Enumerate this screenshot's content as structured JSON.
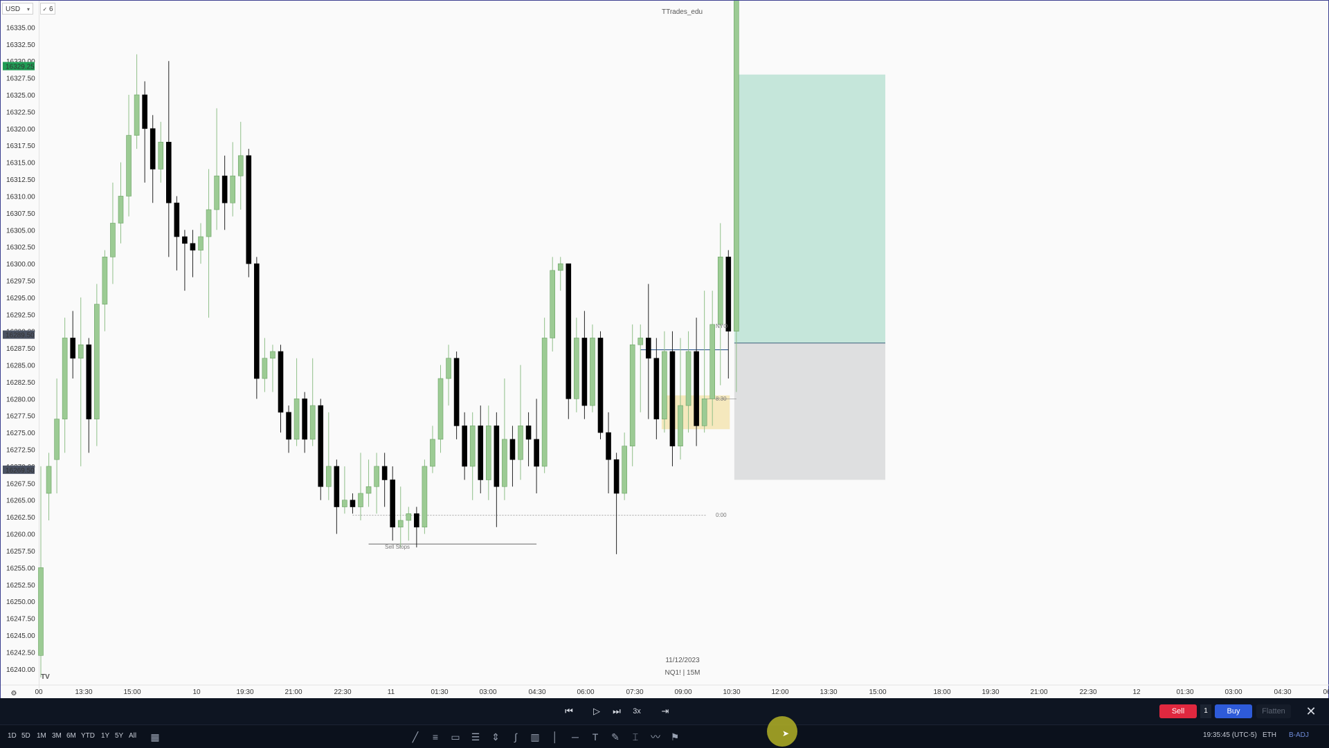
{
  "toolbar": {
    "currency": "USD",
    "interval_badge": "6"
  },
  "chart_data": {
    "type": "candlestick",
    "title": "",
    "y_ticks": [
      "16335.00",
      "16332.50",
      "16330.00",
      "16327.50",
      "16325.00",
      "16322.50",
      "16320.00",
      "16317.50",
      "16315.00",
      "16312.50",
      "16310.00",
      "16307.50",
      "16305.00",
      "16302.50",
      "16300.00",
      "16297.50",
      "16295.00",
      "16292.50",
      "16290.00",
      "16287.50",
      "16285.00",
      "16282.50",
      "16280.00",
      "16277.50",
      "16275.00",
      "16272.50",
      "16270.00",
      "16267.50",
      "16265.00",
      "16262.50",
      "16260.00",
      "16257.50",
      "16255.00",
      "16252.50",
      "16250.00",
      "16247.50",
      "16245.00",
      "16242.50",
      "16240.00"
    ],
    "ylim": [
      16238.75,
      16337.5
    ],
    "price_badges": [
      {
        "value": "16329.25",
        "color": "#1f9d55"
      },
      {
        "value": "16289.50",
        "color": "#4a5263"
      },
      {
        "value": "16269.50",
        "color": "#4a5263"
      }
    ],
    "x_ticks": [
      "00",
      "13:30",
      "15:00",
      "10",
      "19:30",
      "21:00",
      "22:30",
      "11",
      "01:30",
      "03:00",
      "04:30",
      "06:00",
      "07:30",
      "09:00",
      "10:30",
      "12:00",
      "13:30",
      "15:00",
      "18:00",
      "19:30",
      "21:00",
      "22:30",
      "12",
      "01:30",
      "03:00",
      "04:30",
      "06"
    ],
    "up_color": "#9ccb94",
    "down_color": "#000000",
    "candles": [
      [
        16242,
        16255,
        16238.75,
        16270,
        1
      ],
      [
        16266,
        16270,
        16262,
        16272,
        1
      ],
      [
        16271,
        16277,
        16266,
        16283,
        1
      ],
      [
        16277,
        16289,
        16272,
        16292,
        1
      ],
      [
        16289,
        16286,
        16283,
        16293,
        0
      ],
      [
        16286,
        16288,
        16270,
        16295,
        1
      ],
      [
        16288,
        16277,
        16272,
        16289,
        0
      ],
      [
        16277,
        16294,
        16273,
        16297,
        1
      ],
      [
        16294,
        16301,
        16290,
        16302,
        1
      ],
      [
        16301,
        16306,
        16297,
        16312,
        1
      ],
      [
        16306,
        16310,
        16303,
        16315,
        1
      ],
      [
        16310,
        16319,
        16307,
        16325,
        1
      ],
      [
        16319,
        16325,
        16317,
        16331,
        1
      ],
      [
        16325,
        16320,
        16312,
        16327,
        0
      ],
      [
        16320,
        16314,
        16309,
        16322,
        0
      ],
      [
        16314,
        16318,
        16312,
        16321,
        1
      ],
      [
        16318,
        16309,
        16301,
        16330,
        0
      ],
      [
        16309,
        16304,
        16299,
        16310,
        0
      ],
      [
        16304,
        16303,
        16296,
        16305,
        0
      ],
      [
        16303,
        16302,
        16298,
        16305,
        0
      ],
      [
        16302,
        16304,
        16300,
        16306,
        1
      ],
      [
        16304,
        16308,
        16292,
        16314,
        1
      ],
      [
        16308,
        16313,
        16305,
        16323,
        1
      ],
      [
        16313,
        16309,
        16305,
        16316,
        0
      ],
      [
        16309,
        16313,
        16307,
        16318,
        1
      ],
      [
        16313,
        16316,
        16308,
        16321,
        1
      ],
      [
        16316,
        16300,
        16298,
        16317,
        0
      ],
      [
        16300,
        16283,
        16280,
        16301,
        0
      ],
      [
        16283,
        16286,
        16281,
        16289,
        1
      ],
      [
        16286,
        16287,
        16281,
        16288,
        1
      ],
      [
        16287,
        16278,
        16275,
        16288,
        0
      ],
      [
        16278,
        16274,
        16272,
        16279,
        0
      ],
      [
        16274,
        16280,
        16273,
        16286,
        1
      ],
      [
        16280,
        16274,
        16272,
        16281,
        0
      ],
      [
        16274,
        16279,
        16273,
        16286,
        1
      ],
      [
        16279,
        16267,
        16265,
        16280,
        0
      ],
      [
        16267,
        16270,
        16265,
        16278,
        1
      ],
      [
        16270,
        16264,
        16260,
        16271,
        0
      ],
      [
        16264,
        16265,
        16263,
        16270,
        1
      ],
      [
        16265,
        16264,
        16263,
        16266,
        0
      ],
      [
        16264,
        16266,
        16262,
        16272,
        1
      ],
      [
        16266,
        16267,
        16264,
        16271,
        1
      ],
      [
        16267,
        16270,
        16263,
        16272,
        1
      ],
      [
        16270,
        16268,
        16264,
        16272,
        0
      ],
      [
        16268,
        16261,
        16259,
        16270,
        0
      ],
      [
        16261,
        16262,
        16258,
        16267,
        1
      ],
      [
        16262,
        16263,
        16259,
        16264,
        1
      ],
      [
        16263,
        16261,
        16258,
        16264,
        0
      ],
      [
        16261,
        16270,
        16260,
        16271,
        1
      ],
      [
        16270,
        16274,
        16269,
        16276,
        1
      ],
      [
        16274,
        16283,
        16272,
        16285,
        1
      ],
      [
        16283,
        16286,
        16279,
        16288,
        1
      ],
      [
        16286,
        16276,
        16274,
        16287,
        0
      ],
      [
        16276,
        16270,
        16268,
        16278,
        0
      ],
      [
        16270,
        16276,
        16265,
        16278,
        1
      ],
      [
        16276,
        16268,
        16266,
        16279,
        0
      ],
      [
        16268,
        16276,
        16265,
        16279,
        1
      ],
      [
        16276,
        16267,
        16261,
        16278,
        0
      ],
      [
        16267,
        16274,
        16265,
        16283,
        1
      ],
      [
        16274,
        16271,
        16267,
        16276,
        0
      ],
      [
        16271,
        16276,
        16268,
        16285,
        1
      ],
      [
        16276,
        16274,
        16270,
        16278,
        0
      ],
      [
        16274,
        16270,
        16266,
        16280,
        0
      ],
      [
        16270,
        16289,
        16269,
        16292,
        1
      ],
      [
        16289,
        16299,
        16287,
        16301,
        1
      ],
      [
        16299,
        16300,
        16296,
        16301,
        1
      ],
      [
        16300,
        16280,
        16277,
        16300,
        0
      ],
      [
        16280,
        16289,
        16278,
        16292,
        1
      ],
      [
        16289,
        16279,
        16277,
        16293,
        0
      ],
      [
        16279,
        16289,
        16278,
        16291,
        1
      ],
      [
        16289,
        16275,
        16274,
        16290,
        0
      ],
      [
        16275,
        16271,
        16266,
        16278,
        0
      ],
      [
        16271,
        16266,
        16257,
        16272,
        0
      ],
      [
        16266,
        16273,
        16265,
        16275,
        1
      ],
      [
        16273,
        16288,
        16270,
        16291,
        1
      ],
      [
        16288,
        16289,
        16278,
        16291,
        1
      ],
      [
        16289,
        16286,
        16277,
        16297,
        0
      ],
      [
        16286,
        16277,
        16274,
        16289,
        0
      ],
      [
        16277,
        16287,
        16275,
        16290,
        1
      ],
      [
        16287,
        16273,
        16270,
        16290,
        0
      ],
      [
        16273,
        16279,
        16271,
        16289,
        1
      ],
      [
        16279,
        16287,
        16275,
        16290,
        1
      ],
      [
        16287,
        16276,
        16273,
        16292,
        0
      ],
      [
        16276,
        16280,
        16275,
        16296,
        1
      ],
      [
        16280,
        16291,
        16276,
        16296,
        1
      ],
      [
        16291,
        16301,
        16282,
        16306,
        1
      ],
      [
        16301,
        16290,
        16283,
        16302,
        0
      ],
      [
        16290,
        16353,
        16281,
        16353,
        1
      ],
      [
        16353,
        16353,
        16352,
        16353,
        0
      ]
    ],
    "annotations": [
      {
        "text": "TTrades_edu"
      },
      {
        "text": "NYO"
      },
      {
        "text": "8:30"
      },
      {
        "text": "0:00"
      },
      {
        "text": "Sell Stops"
      },
      {
        "text": "11/12/2023"
      },
      {
        "text": "NQ1! | 15M"
      }
    ],
    "position_target_color": "#c5e6da",
    "position_stop_color": "#dedfe0",
    "fvg_color": "#f5e8bd"
  },
  "replay": {
    "speed_label": "3x"
  },
  "timeframes": [
    "1D",
    "5D",
    "1M",
    "3M",
    "6M",
    "YTD",
    "1Y",
    "5Y",
    "All"
  ],
  "trade": {
    "sell_label": "Sell",
    "qty": "1",
    "buy_label": "Buy",
    "flatten_label": "Flatten"
  },
  "status": {
    "clock": "19:35:45 (UTC-5)",
    "session": "ETH",
    "adj": "B-ADJ"
  }
}
